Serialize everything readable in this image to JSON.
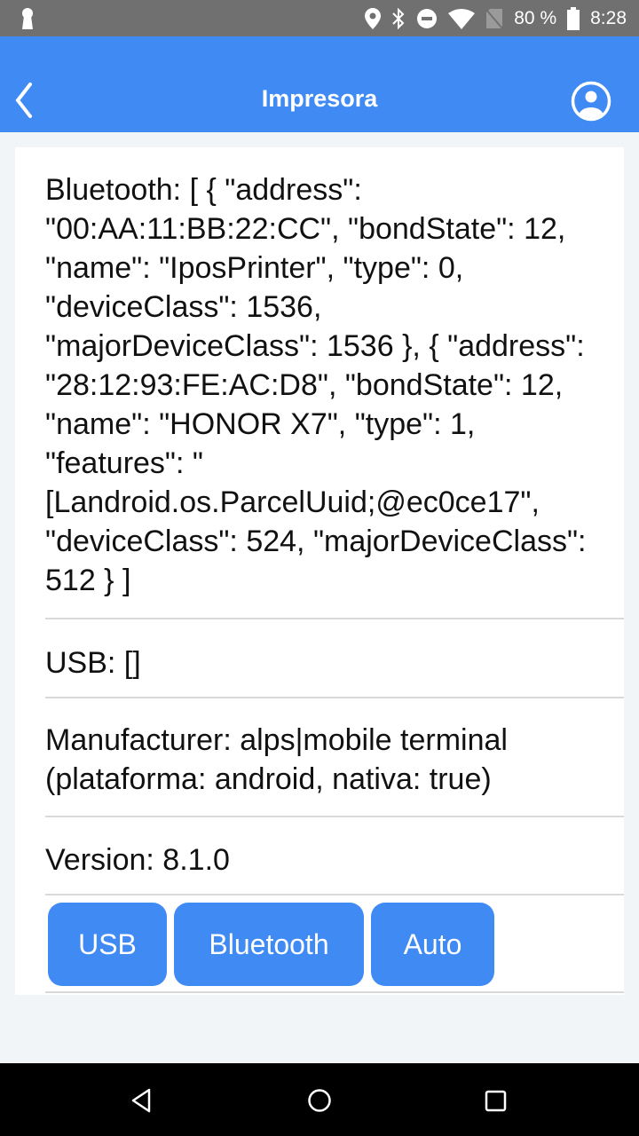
{
  "status_bar": {
    "battery_percent": "80 %",
    "time": "8:28",
    "icons": [
      "keyhole-icon",
      "location-icon",
      "bluetooth-icon",
      "do-not-disturb-icon",
      "wifi-icon",
      "no-sim-icon",
      "battery-icon"
    ]
  },
  "app_bar": {
    "title": "Impresora",
    "back_icon": "chevron-left-icon",
    "profile_icon": "user-circle-icon"
  },
  "info": {
    "bluetooth": "Bluetooth: [ { \"address\": \"00:AA:11:BB:22:CC\", \"bondState\": 12, \"name\": \"IposPrinter\", \"type\": 0, \"deviceClass\": 1536, \"majorDeviceClass\": 1536 }, { \"address\": \"28:12:93:FE:AC:D8\", \"bondState\": 12, \"name\": \"HONOR X7\", \"type\": 1, \"features\": \"[Landroid.os.ParcelUuid;@ec0ce17\", \"deviceClass\": 524, \"majorDeviceClass\": 512 } ]",
    "usb": "USB: []",
    "manufacturer": "Manufacturer: alps|mobile terminal (plataforma: android, nativa: true)",
    "version": "Version: 8.1.0"
  },
  "buttons": {
    "usb": "USB",
    "bluetooth": "Bluetooth",
    "auto": "Auto"
  },
  "nav_bar": {
    "back": "back-triangle-icon",
    "home": "home-circle-icon",
    "recents": "recents-square-icon"
  }
}
